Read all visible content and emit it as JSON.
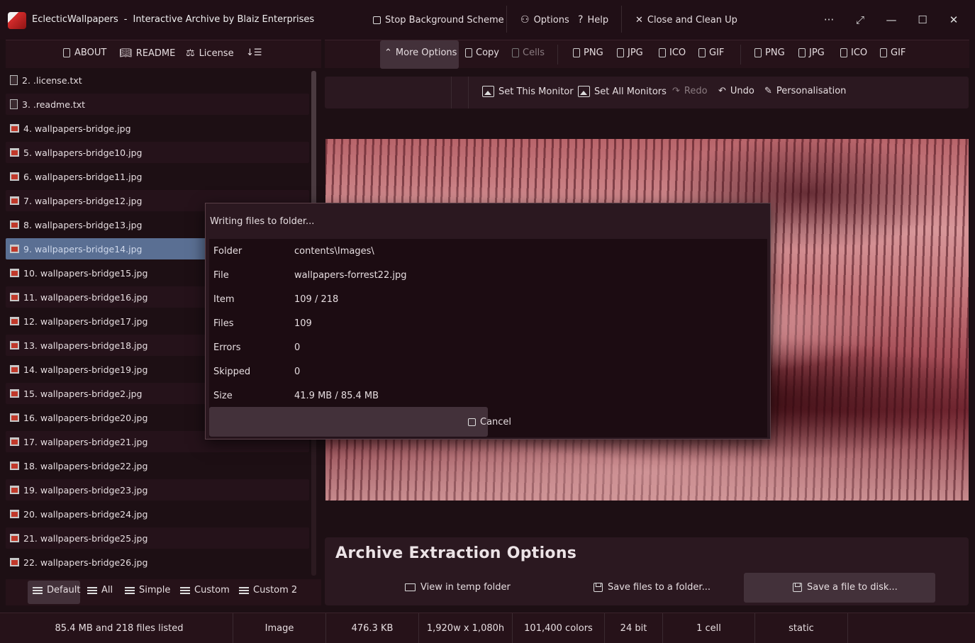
{
  "titlebar": {
    "app_name": "EclecticWallpapers",
    "separator": "-",
    "subtitle": "Interactive Archive by Blaiz Enterprises",
    "stop_bg": "Stop Background Scheme",
    "options": "Options",
    "help": "Help",
    "close_clean": "Close and Clean Up",
    "more_glyph": "···",
    "expand_glyph": "⤢",
    "minimize_glyph": "—",
    "maximize_glyph": "☐",
    "close_glyph": "✕"
  },
  "left_toolbar": {
    "about": "ABOUT",
    "readme": "README",
    "license": "License",
    "sort_glyph": "↓☰"
  },
  "right_toolbar": {
    "more_options": "More Options",
    "copy": "Copy",
    "cells": "Cells",
    "group1": [
      "PNG",
      "JPG",
      "ICO",
      "GIF"
    ],
    "group2": [
      "PNG",
      "JPG",
      "ICO",
      "GIF"
    ]
  },
  "files": [
    "2.  .license.txt",
    "3.  .readme.txt",
    "4.  wallpapers-bridge.jpg",
    "5.  wallpapers-bridge10.jpg",
    "6.  wallpapers-bridge11.jpg",
    "7.  wallpapers-bridge12.jpg",
    "8.  wallpapers-bridge13.jpg",
    "9.  wallpapers-bridge14.jpg",
    "10.  wallpapers-bridge15.jpg",
    "11.  wallpapers-bridge16.jpg",
    "12.  wallpapers-bridge17.jpg",
    "13.  wallpapers-bridge18.jpg",
    "14.  wallpapers-bridge19.jpg",
    "15.  wallpapers-bridge2.jpg",
    "16.  wallpapers-bridge20.jpg",
    "17.  wallpapers-bridge21.jpg",
    "18.  wallpapers-bridge22.jpg",
    "19.  wallpapers-bridge23.jpg",
    "20.  wallpapers-bridge24.jpg",
    "21.  wallpapers-bridge25.jpg",
    "22.  wallpapers-bridge26.jpg"
  ],
  "view_tabs": {
    "default": "Default",
    "all": "All",
    "simple": "Simple",
    "custom": "Custom",
    "custom2": "Custom 2"
  },
  "monitor_bar": {
    "set_this": "Set This Monitor",
    "set_all": "Set All Monitors",
    "redo": "Redo",
    "undo": "Undo",
    "personalisation": "Personalisation"
  },
  "archive": {
    "title": "Archive Extraction Options",
    "view_temp": "View in temp folder",
    "save_folder": "Save files to a folder...",
    "save_file": "Save a file to disk..."
  },
  "status": {
    "listed": "85.4 MB and 218 files listed",
    "type": "Image",
    "size": "476.3 KB",
    "dims": "1,920w x 1,080h",
    "colors": "101,400 colors",
    "bits": "24 bit",
    "cells": "1 cell",
    "mode": "static"
  },
  "dialog": {
    "title": "Writing files to folder...",
    "rows": [
      {
        "label": "Folder",
        "value": "contents\\Images\\"
      },
      {
        "label": "File",
        "value": "wallpapers-forrest22.jpg"
      },
      {
        "label": "Item",
        "value": "109 / 218"
      },
      {
        "label": "Files",
        "value": "109"
      },
      {
        "label": "Errors",
        "value": "0"
      },
      {
        "label": "Skipped",
        "value": "0"
      },
      {
        "label": "Size",
        "value": "41.9 MB / 85.4 MB"
      }
    ],
    "cancel": "Cancel"
  }
}
